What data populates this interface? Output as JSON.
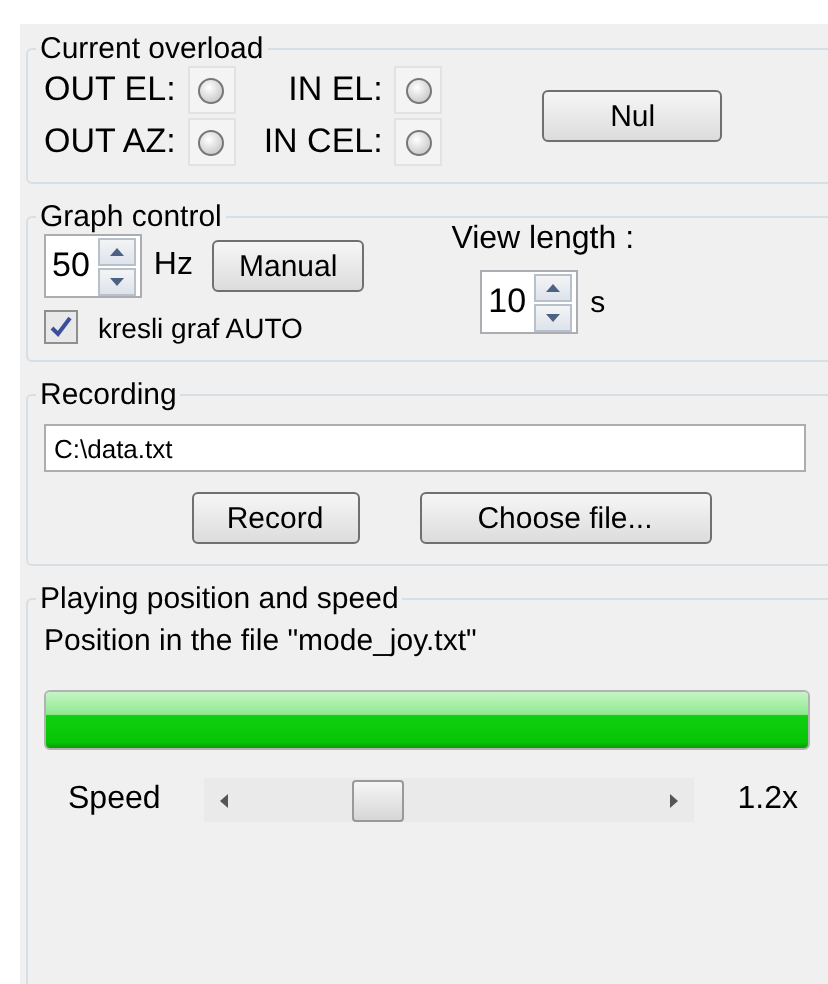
{
  "overload": {
    "title": "Current overload",
    "indicators": [
      {
        "label": "OUT EL:",
        "lit": false
      },
      {
        "label": "IN EL:",
        "lit": false
      },
      {
        "label": "OUT AZ:",
        "lit": false
      },
      {
        "label": "IN CEL:",
        "lit": false
      }
    ],
    "button": "Nul"
  },
  "graph": {
    "title": "Graph control",
    "rate": {
      "value": "50",
      "unit": "Hz"
    },
    "manual_button": "Manual",
    "auto": {
      "label": "kresli graf AUTO",
      "checked": true
    },
    "view_length": {
      "label": "View length :",
      "value": "10",
      "unit": "s"
    }
  },
  "recording": {
    "title": "Recording",
    "path": "C:\\data.txt",
    "record_button": "Record",
    "choose_button": "Choose file..."
  },
  "playing": {
    "title": "Playing position and speed",
    "position_label": "Position in the file \"mode_joy.txt\"",
    "progress": {
      "level": 1
    },
    "speed": {
      "label": "Speed",
      "level": 0.3,
      "reading": "1.2x"
    }
  }
}
